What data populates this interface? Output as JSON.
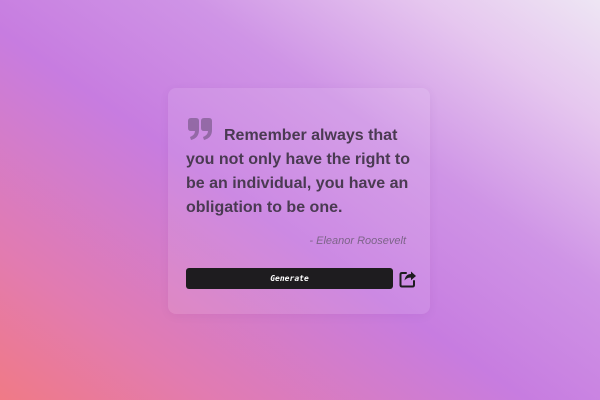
{
  "quote": {
    "text": "Remember always that you not only have the right to be an individual, you have an obligation to be one.",
    "author": "- Eleanor Roosevelt"
  },
  "actions": {
    "generate_label": "Generate"
  },
  "icons": {
    "quote": "quote-icon",
    "share": "share-icon"
  },
  "colors": {
    "card_text": "#4a3a52",
    "button_background": "#1e1c1f",
    "button_text": "#ffffff"
  }
}
